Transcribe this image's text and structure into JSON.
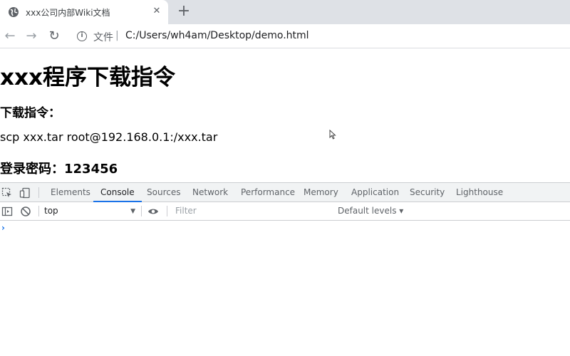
{
  "browser": {
    "tab_title": "xxx公司内部Wiki文档",
    "tab_close": "✕",
    "new_tab": "+",
    "file_label": "文件",
    "url_separator": "|",
    "url": "C:/Users/wh4am/Desktop/demo.html"
  },
  "page": {
    "heading": "xxx程序下载指令",
    "command_label": "下载指令：",
    "command": "scp xxx.tar root@192.168.0.1:/xxx.tar",
    "password_line": "登录密码：123456"
  },
  "devtools": {
    "tabs": [
      {
        "label": "Elements"
      },
      {
        "label": "Console"
      },
      {
        "label": "Sources"
      },
      {
        "label": "Network"
      },
      {
        "label": "Performance"
      },
      {
        "label": "Memory"
      },
      {
        "label": "Application"
      },
      {
        "label": "Security"
      },
      {
        "label": "Lighthouse"
      }
    ],
    "active_tab": "Console",
    "context": "top",
    "filter_placeholder": "Filter",
    "levels": "Default levels ▾",
    "prompt": "›"
  },
  "colors": {
    "tabstrip": "#dee1e6",
    "accent": "#1a73e8"
  }
}
